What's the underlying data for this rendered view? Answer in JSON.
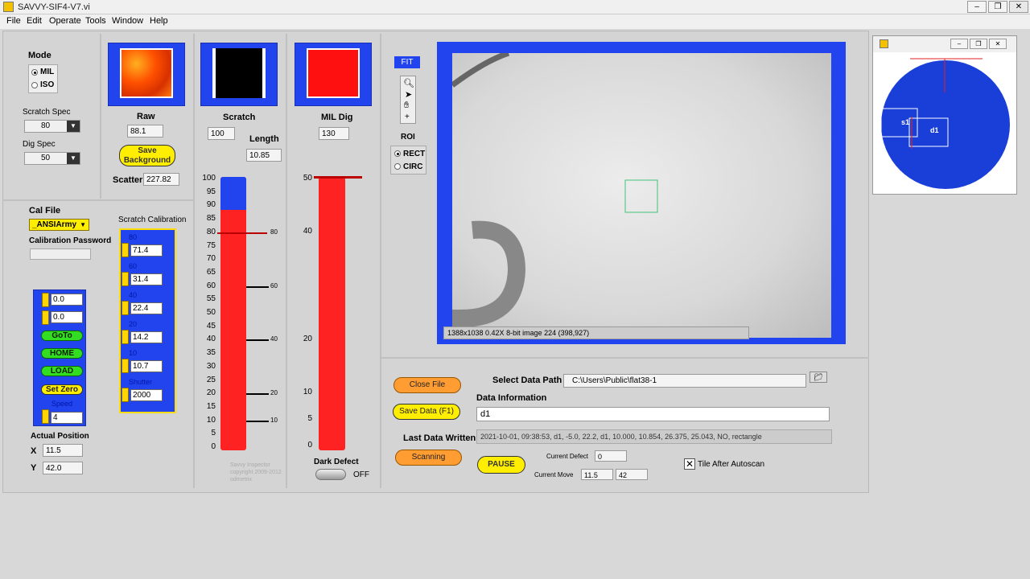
{
  "window": {
    "title": "SAVVY-SIF4-V7.vi"
  },
  "menu": [
    "File",
    "Edit",
    "Operate",
    "Tools",
    "Window",
    "Help"
  ],
  "mode": {
    "label": "Mode",
    "options": [
      "MIL",
      "ISO"
    ],
    "selected": "MIL"
  },
  "scratch_spec": {
    "label": "Scratch Spec",
    "value": "80"
  },
  "dig_spec": {
    "label": "Dig Spec",
    "value": "50"
  },
  "raw": {
    "label": "Raw",
    "value": "88.1",
    "save_bg_label": "Save Background",
    "scatter_label": "Scatter",
    "scatter_value": "227.82"
  },
  "scratch": {
    "label": "Scratch",
    "value": "100",
    "length_label": "Length",
    "length_value": "10.85"
  },
  "mil_dig": {
    "label": "MIL Dig",
    "value": "130"
  },
  "cal": {
    "file_label": "Cal File",
    "file_value": "_ANSIArmy",
    "password_label": "Calibration Password",
    "scratch_cal_label": "Scratch Calibration"
  },
  "scratch_cal": [
    {
      "key": "80",
      "value": "71.4"
    },
    {
      "key": "60",
      "value": "31.4"
    },
    {
      "key": "40",
      "value": "22.4"
    },
    {
      "key": "20",
      "value": "14.2"
    },
    {
      "key": "10",
      "value": "10.7"
    },
    {
      "key": "Shutter",
      "value": "2000"
    }
  ],
  "stage": {
    "x_input": "0.0",
    "y_input": "0.0",
    "goto": "GoTo",
    "home": "HOME",
    "load": "LOAD",
    "set_zero": "Set Zero",
    "speed_label": "Speed",
    "speed": "4"
  },
  "actual_position": {
    "label": "Actual Position",
    "x_label": "X",
    "x": "11.5",
    "y_label": "Y",
    "y": "42.0"
  },
  "scratch_gauge": {
    "ticks": [
      "100",
      "95",
      "90",
      "85",
      "80",
      "75",
      "70",
      "65",
      "60",
      "55",
      "50",
      "45",
      "40",
      "35",
      "30",
      "25",
      "20",
      "15",
      "10",
      "5",
      "0"
    ],
    "fill_percent": 88,
    "markers": [
      "80",
      "60",
      "40",
      "20",
      "10"
    ]
  },
  "dig_gauge": {
    "ticks": [
      "50",
      "40",
      "20",
      "10",
      "5",
      "0"
    ],
    "fill_value": 50
  },
  "copyright": "Savvy Inspector\ncopyright 2009-2012\nodmetrix",
  "dark_defect": {
    "label": "Dark Defect",
    "state": "OFF"
  },
  "toolbar": {
    "fit": "FIT"
  },
  "roi": {
    "label": "ROI",
    "options": [
      "RECT",
      "CIRC"
    ],
    "selected": "RECT"
  },
  "image_status": "1388x1038 0.42X 8-bit image 224    (398,927)",
  "data": {
    "close_file": "Close File",
    "select_path_label": "Select Data Path",
    "path_value": "C:\\Users\\Public\\flat38-1",
    "info_label": "Data Information",
    "info_value": "d1",
    "save_data": "Save Data (F1)",
    "last_written_label": "Last Data Written",
    "last_written_value": "2021-10-01, 09:38:53, d1, -5.0, 22.2, d1, 10.000, 10.854, 26.375, 25.043, NO, rectangle",
    "scanning": "Scanning",
    "pause": "PAUSE",
    "current_defect_label": "Current Defect",
    "current_defect": "0",
    "current_move_label": "Current Move",
    "move_x": "11.5",
    "move_y": "42",
    "tile_label": "Tile After Autoscan"
  },
  "map": {
    "s1": "s1",
    "d1": "d1"
  }
}
